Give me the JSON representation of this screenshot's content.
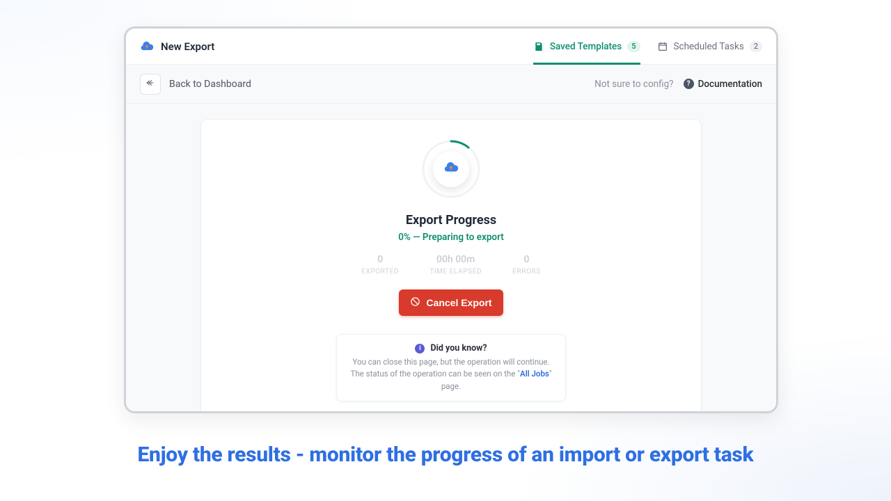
{
  "header": {
    "title": "New Export",
    "tabs": [
      {
        "label": "Saved Templates",
        "count": "5"
      },
      {
        "label": "Scheduled Tasks",
        "count": "2"
      }
    ]
  },
  "subheader": {
    "back_label": "Back to Dashboard",
    "help_prompt": "Not sure to config?",
    "doc_label": "Documentation"
  },
  "progress": {
    "title": "Export Progress",
    "status_text": "0% — Preparing to export",
    "stats": {
      "exported_val": "0",
      "exported_lbl": "EXPORTED",
      "time_val": "00h 00m",
      "time_lbl": "TIME ELAPSED",
      "errors_val": "0",
      "errors_lbl": "ERRORS"
    },
    "cancel_label": "Cancel Export"
  },
  "tip": {
    "title": "Did you know?",
    "line1": "You can close this page, but the operation will continue.",
    "line2_pre": "The status of the operation can be seen on the \"",
    "link": "All Jobs",
    "line2_post": "\" page."
  },
  "caption": "Enjoy the results - monitor the progress of an import or export task",
  "colors": {
    "accent_green": "#0f8f6f",
    "danger": "#d83a2b",
    "brand_blue": "#2f6fe3"
  }
}
